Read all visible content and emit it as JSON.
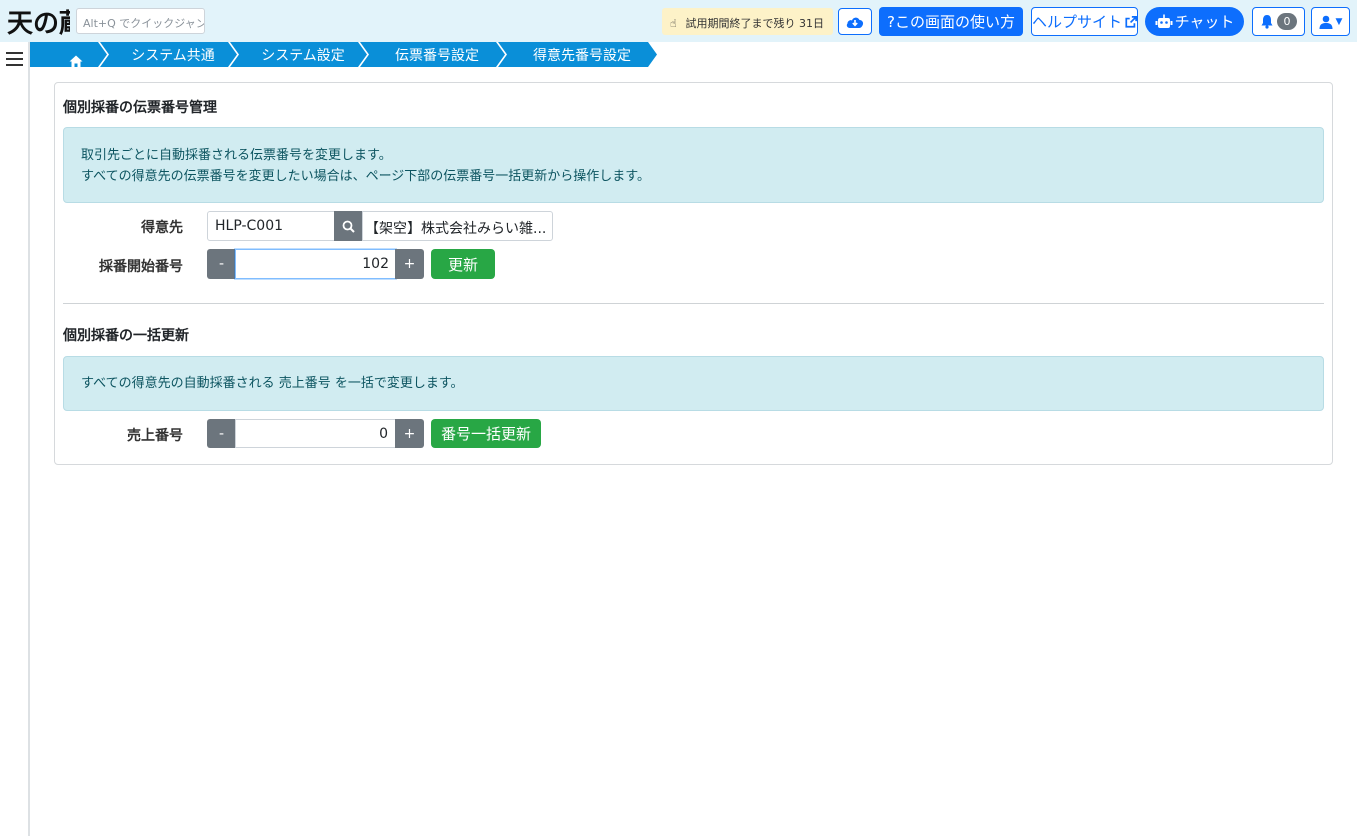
{
  "header": {
    "logo_text": "天の蔵",
    "quick_jump_placeholder": "Alt+Q でクイックジャンプ",
    "trial_text": "試用期間終了まで残り 31日",
    "howto_label": "?この画面の使い方",
    "help_site_label": "ヘルプサイト",
    "chat_label": "チャット",
    "notification_count": "0"
  },
  "breadcrumb": {
    "items": [
      "システム共通",
      "システム設定",
      "伝票番号設定",
      "得意先番号設定"
    ]
  },
  "section1": {
    "title": "個別採番の伝票番号管理",
    "info_line1": "取引先ごとに自動採番される伝票番号を変更します。",
    "info_line2": "すべての得意先の伝票番号を変更したい場合は、ページ下部の伝票番号一括更新から操作します。",
    "customer_label": "得意先",
    "customer_code": "HLP-C001",
    "customer_name": "【架空】株式会社みらい雑...",
    "start_number_label": "採番開始番号",
    "start_number_value": "102",
    "minus_label": "-",
    "plus_label": "+",
    "update_label": "更新"
  },
  "section2": {
    "title": "個別採番の一括更新",
    "info_text": "すべての得意先の自動採番される 売上番号 を一括で変更します。",
    "sales_number_label": "売上番号",
    "sales_number_value": "0",
    "minus_label": "-",
    "plus_label": "+",
    "bulk_update_label": "番号一括更新"
  },
  "colors": {
    "topbar": "#e2f3fa",
    "primary": "#0d6efd",
    "breadcrumb": "#0a8fd8",
    "success": "#28a745",
    "info_bg": "#d1ecf1",
    "secondary": "#6c757d"
  },
  "icons": [
    "hamburger-icon",
    "home-icon",
    "search-icon",
    "download-cloud-icon",
    "external-link-icon",
    "robot-icon",
    "bell-icon",
    "user-icon",
    "hand-pointer-icon"
  ]
}
